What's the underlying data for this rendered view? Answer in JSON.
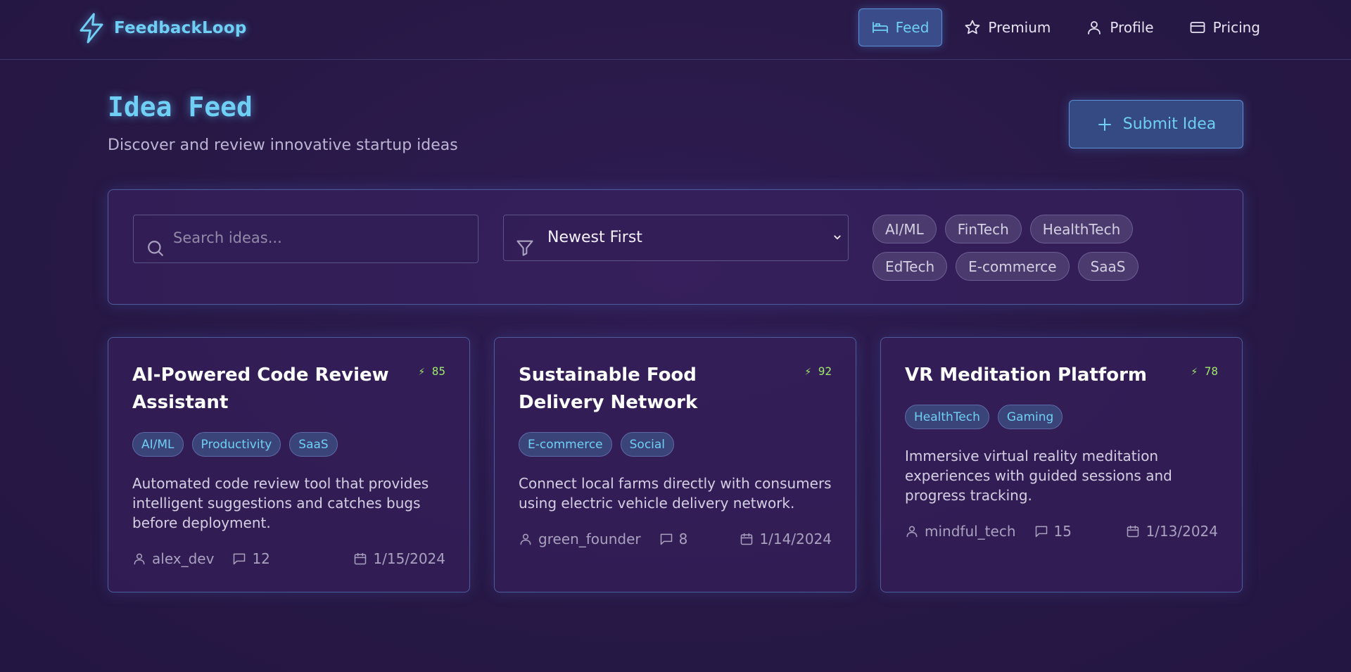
{
  "brand": {
    "name": "FeedbackLoop"
  },
  "nav": [
    {
      "label": "Feed",
      "active": true
    },
    {
      "label": "Premium",
      "active": false
    },
    {
      "label": "Profile",
      "active": false
    },
    {
      "label": "Pricing",
      "active": false
    }
  ],
  "page": {
    "title": "Idea Feed",
    "subtitle": "Discover and review innovative startup ideas",
    "submit_label": "Submit Idea"
  },
  "filters": {
    "search_placeholder": "Search ideas...",
    "sort_value": "Newest First",
    "tags": [
      "AI/ML",
      "FinTech",
      "HealthTech",
      "EdTech",
      "E-commerce",
      "SaaS"
    ]
  },
  "ideas": [
    {
      "title": "AI-Powered Code Review Assistant",
      "score": "⚡ 85",
      "tags": [
        "AI/ML",
        "Productivity",
        "SaaS"
      ],
      "description": "Automated code review tool that provides intelligent suggestions and catches bugs before deployment.",
      "author": "alex_dev",
      "comments": "12",
      "date": "1/15/2024"
    },
    {
      "title": "Sustainable Food Delivery Network",
      "score": "⚡ 92",
      "tags": [
        "E-commerce",
        "Social"
      ],
      "description": "Connect local farms directly with consumers using electric vehicle delivery network.",
      "author": "green_founder",
      "comments": "8",
      "date": "1/14/2024"
    },
    {
      "title": "VR Meditation Platform",
      "score": "⚡ 78",
      "tags": [
        "HealthTech",
        "Gaming"
      ],
      "description": "Immersive virtual reality meditation experiences with guided sessions and progress tracking.",
      "author": "mindful_tech",
      "comments": "15",
      "date": "1/13/2024"
    }
  ],
  "colors": {
    "accent": "#6fcff5",
    "background": "#2a1a4a",
    "score": "#9ee86a"
  }
}
